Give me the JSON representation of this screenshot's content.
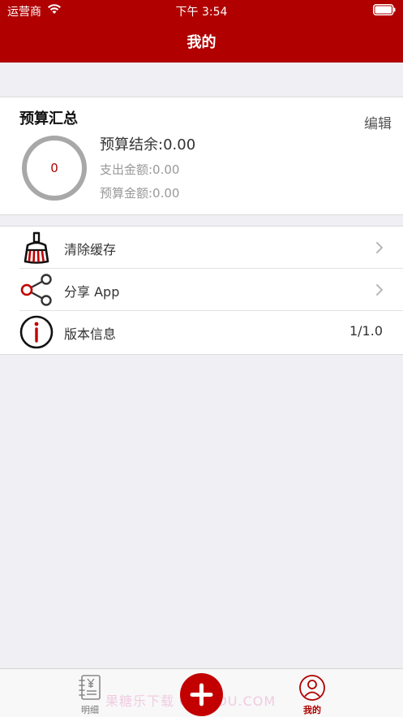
{
  "status_bar": {
    "carrier": "运营商",
    "time": "下午 3:54"
  },
  "nav": {
    "title": "我的"
  },
  "budget": {
    "title": "预算汇总",
    "edit_label": "编辑",
    "ring_value": "0",
    "balance": "预算结余:0.00",
    "expense": "支出金额:0.00",
    "amount": "预算金额:0.00"
  },
  "menu": {
    "items": [
      {
        "label": "清除缓存",
        "icon": "broom-icon"
      },
      {
        "label": "分享 App",
        "icon": "share-icon"
      },
      {
        "label": "版本信息",
        "icon": "info-icon",
        "value": "1/1.0"
      }
    ]
  },
  "tabbar": {
    "detail_label": "明细",
    "mine_label": "我的",
    "watermark": "果糖乐下载 GXLEDU.COM"
  },
  "colors": {
    "brand": "#b00000",
    "background": "#efeff4"
  }
}
